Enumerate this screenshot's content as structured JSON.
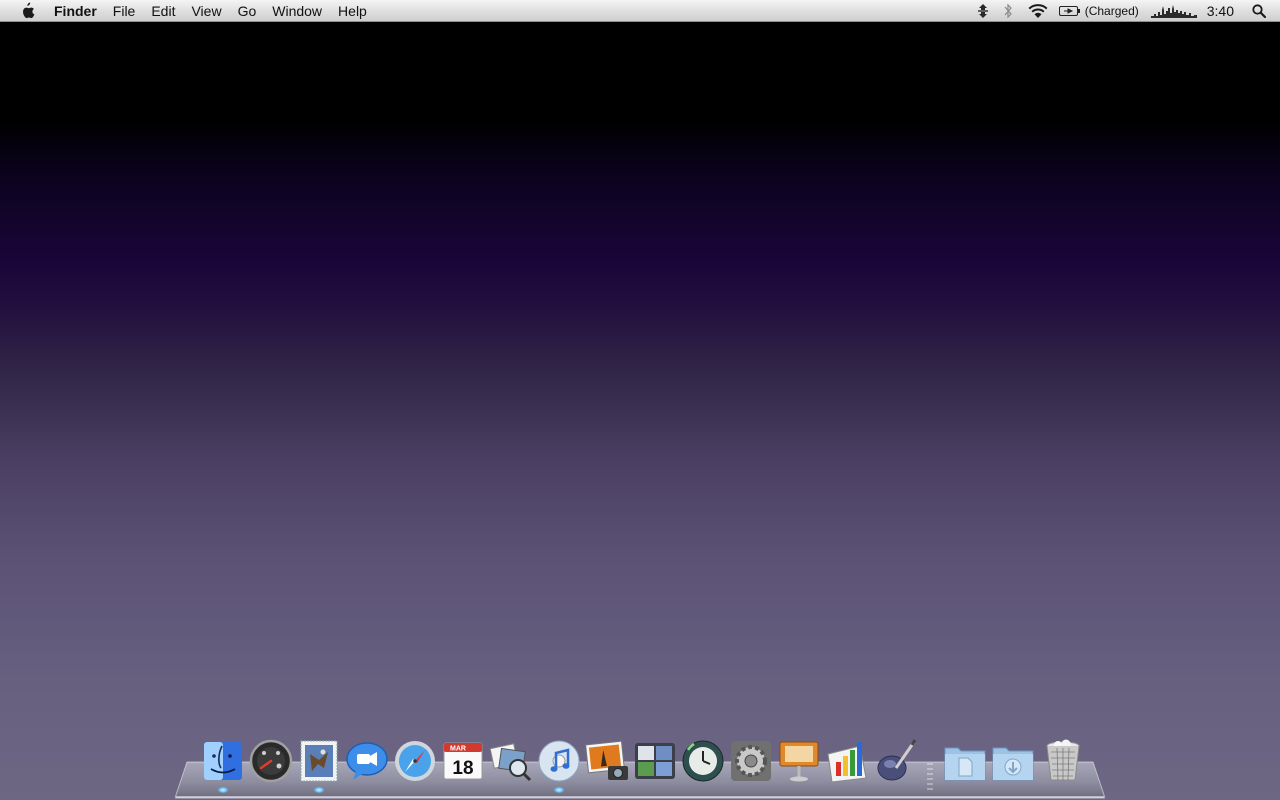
{
  "menubar": {
    "apple_icon": "apple-logo-icon",
    "app_name": "Finder",
    "menus": [
      "File",
      "Edit",
      "View",
      "Go",
      "Window",
      "Help"
    ],
    "status": {
      "battery_label": "(Charged)",
      "clock": "3:40"
    }
  },
  "dock": {
    "apps": [
      {
        "name": "Finder",
        "icon": "finder-icon"
      },
      {
        "name": "Dashboard",
        "icon": "dashboard-icon"
      },
      {
        "name": "Mail",
        "icon": "mail-icon"
      },
      {
        "name": "iChat",
        "icon": "ichat-icon"
      },
      {
        "name": "Safari",
        "icon": "safari-icon"
      },
      {
        "name": "iCal",
        "icon": "ical-icon",
        "month": "MAR",
        "day": "18"
      },
      {
        "name": "Preview",
        "icon": "preview-icon"
      },
      {
        "name": "iTunes",
        "icon": "itunes-icon"
      },
      {
        "name": "iPhoto",
        "icon": "iphoto-icon"
      },
      {
        "name": "Spaces",
        "icon": "spaces-icon"
      },
      {
        "name": "Time Machine",
        "icon": "time-machine-icon"
      },
      {
        "name": "System Preferences",
        "icon": "system-preferences-icon"
      },
      {
        "name": "Keynote",
        "icon": "keynote-icon"
      },
      {
        "name": "Numbers",
        "icon": "numbers-icon"
      },
      {
        "name": "Script Editor",
        "icon": "script-editor-icon"
      }
    ],
    "stacks": [
      {
        "name": "Documents",
        "icon": "documents-folder-icon"
      },
      {
        "name": "Downloads",
        "icon": "downloads-folder-icon"
      }
    ],
    "trash": {
      "name": "Trash",
      "icon": "trash-icon"
    },
    "accent": "#6ec7ff"
  }
}
